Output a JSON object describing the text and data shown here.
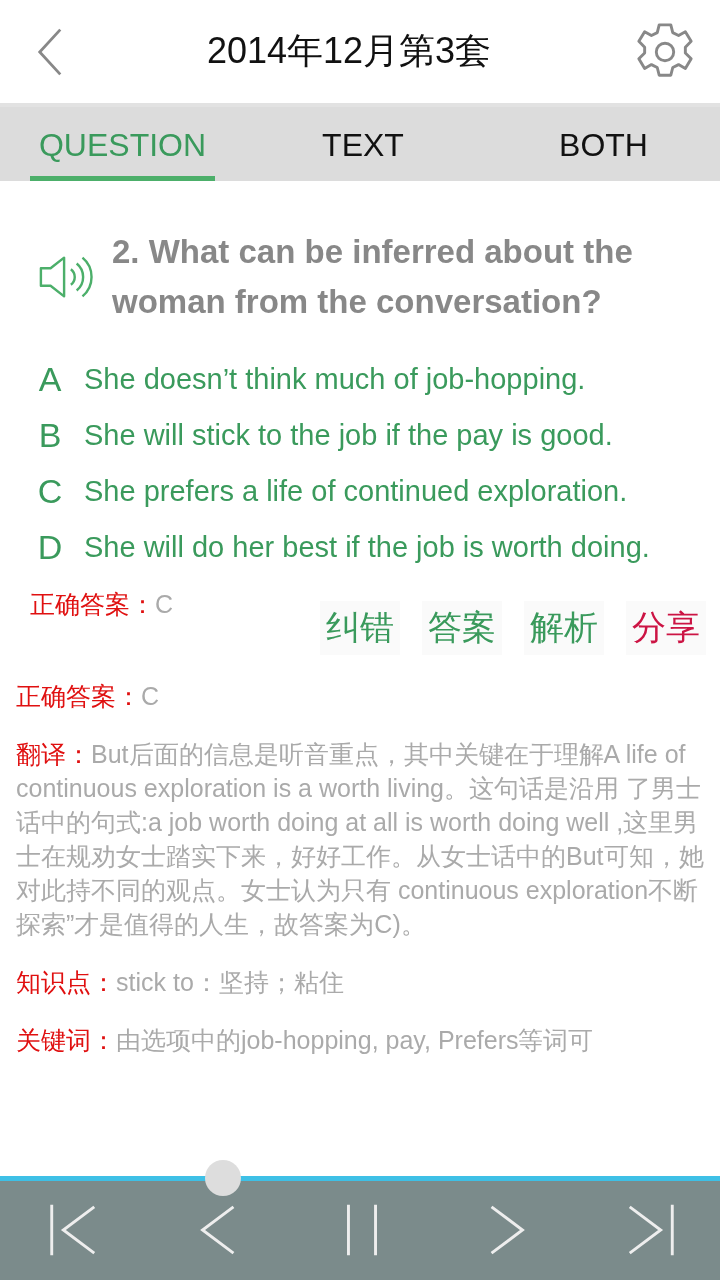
{
  "header": {
    "title": "2014年12月第3套"
  },
  "tabs": [
    {
      "label": "QUESTION",
      "selected": true
    },
    {
      "label": "TEXT",
      "selected": false
    },
    {
      "label": "BOTH",
      "selected": false
    }
  ],
  "question": {
    "text": "2. What can be inferred about the woman from the conversation?"
  },
  "options": [
    {
      "letter": "A",
      "text": "She doesn’t think much of job-hopping."
    },
    {
      "letter": "B",
      "text": "She will stick to the job if the pay is good."
    },
    {
      "letter": "C",
      "text": "She prefers a life of continued exploration."
    },
    {
      "letter": "D",
      "text": "She will do her best if the job is worth doing."
    }
  ],
  "answer_line": {
    "label": "正确答案：",
    "value": "C"
  },
  "actions": [
    {
      "label": "纠错",
      "color": "#3a9a5c"
    },
    {
      "label": "答案",
      "color": "#3a9a5c"
    },
    {
      "label": "解析",
      "color": "#3a9a5c"
    },
    {
      "label": "分享",
      "color": "#cc1444"
    }
  ],
  "details": [
    {
      "label": "正确答案：",
      "value": "C"
    },
    {
      "label": "翻译：",
      "value": "But后面的信息是听音重点，其中关键在于理解A life of continuous exploration is a worth living。这句话是沿用 了男士话中的句式:a job worth doing at all is worth doing well ,这里男士在规劝女士踏实下来，好好工作。从女士话中的But可知，她对此持不同的观点。女士认为只有 continuous exploration不断探索”才是值得的人生，故答案为C)。"
    },
    {
      "label": "知识点：",
      "value": "stick to：坚持；粘住"
    },
    {
      "label": "关键词：",
      "value": "由选项中的job-hopping, pay, Prefers等词可"
    }
  ],
  "player": {
    "level": 0.31
  }
}
